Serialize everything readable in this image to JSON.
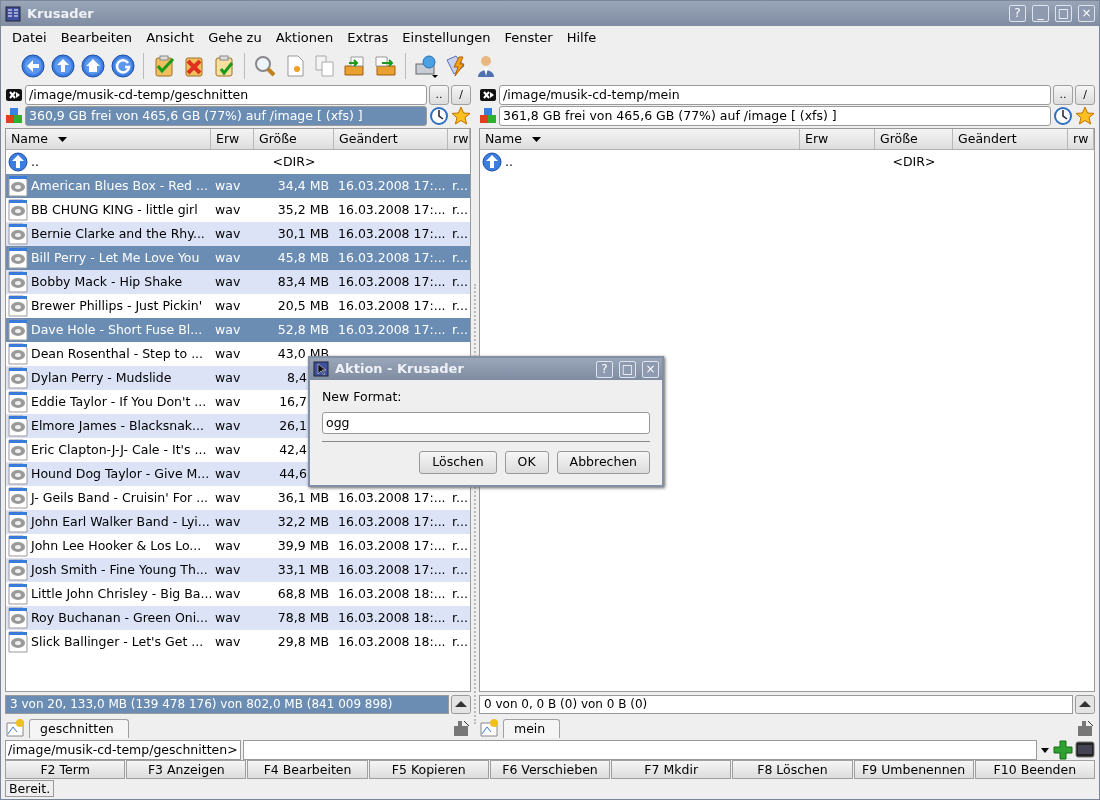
{
  "window": {
    "title": "Krusader",
    "controls": [
      "?",
      "_",
      "□",
      "×"
    ]
  },
  "menu": [
    "Datei",
    "Bearbeiten",
    "Ansicht",
    "Gehe zu",
    "Aktionen",
    "Extras",
    "Einstellungen",
    "Fenster",
    "Hilfe"
  ],
  "panels": [
    {
      "active": true,
      "path": "/image/musik-cd-temp/geschnitten",
      "path_buttons": [
        "..",
        "/"
      ],
      "free_space": "360,9 GB frei von 465,6 GB (77%) auf /image [ (xfs) ]",
      "columns": [
        "Name",
        "Erw",
        "Größe",
        "Geändert",
        "rw"
      ],
      "rows": [
        {
          "kind": "parent",
          "name": "..",
          "size": "<DIR>",
          "selected": false
        },
        {
          "kind": "file",
          "name": "American Blues Box - Red ...",
          "ext": "wav",
          "size": "34,4 MB",
          "date": "16.03.2008 17:...",
          "rw": "r...",
          "selected": true
        },
        {
          "kind": "file",
          "name": "BB CHUNG KING - little girl",
          "ext": "wav",
          "size": "35,2 MB",
          "date": "16.03.2008 17:...",
          "rw": "r...",
          "selected": false
        },
        {
          "kind": "file",
          "name": "Bernie Clarke and the Rhy...",
          "ext": "wav",
          "size": "30,1 MB",
          "date": "16.03.2008 17:...",
          "rw": "r...",
          "selected": false
        },
        {
          "kind": "file",
          "name": "Bill Perry - Let Me Love You",
          "ext": "wav",
          "size": "45,8 MB",
          "date": "16.03.2008 17:...",
          "rw": "r...",
          "selected": true
        },
        {
          "kind": "file",
          "name": "Bobby Mack - Hip Shake",
          "ext": "wav",
          "size": "83,4 MB",
          "date": "16.03.2008 17:...",
          "rw": "r...",
          "selected": false
        },
        {
          "kind": "file",
          "name": "Brewer Phillips - Just Pickin'",
          "ext": "wav",
          "size": "20,5 MB",
          "date": "16.03.2008 17:...",
          "rw": "r...",
          "selected": false
        },
        {
          "kind": "file",
          "name": "Dave Hole - Short Fuse Bl...",
          "ext": "wav",
          "size": "52,8 MB",
          "date": "16.03.2008 17:...",
          "rw": "r...",
          "selected": true
        },
        {
          "kind": "file",
          "name": "Dean Rosenthal - Step to ...",
          "ext": "wav",
          "size": "43,0 MB",
          "selected": false
        },
        {
          "kind": "file",
          "name": "Dylan Perry - Mudslide",
          "ext": "wav",
          "size": "8,4",
          "selected": false
        },
        {
          "kind": "file",
          "name": "Eddie Taylor - If You Don't ...",
          "ext": "wav",
          "size": "16,7",
          "selected": false
        },
        {
          "kind": "file",
          "name": "Elmore James - Blacksnak...",
          "ext": "wav",
          "size": "26,1",
          "selected": false
        },
        {
          "kind": "file",
          "name": "Eric Clapton-J-J- Cale - It's ...",
          "ext": "wav",
          "size": "42,4",
          "selected": false
        },
        {
          "kind": "file",
          "name": "Hound Dog Taylor - Give M...",
          "ext": "wav",
          "size": "44,6",
          "selected": false
        },
        {
          "kind": "file",
          "name": "J- Geils Band - Cruisin' For ...",
          "ext": "wav",
          "size": "36,1 MB",
          "date": "16.03.2008 17:...",
          "rw": "r...",
          "selected": false
        },
        {
          "kind": "file",
          "name": "John Earl Walker Band - Lyi...",
          "ext": "wav",
          "size": "32,2 MB",
          "date": "16.03.2008 17:...",
          "rw": "r...",
          "selected": false
        },
        {
          "kind": "file",
          "name": "John Lee Hooker & Los Lo...",
          "ext": "wav",
          "size": "39,9 MB",
          "date": "16.03.2008 17:...",
          "rw": "r...",
          "selected": false
        },
        {
          "kind": "file",
          "name": "Josh Smith - Fine Young Th...",
          "ext": "wav",
          "size": "33,1 MB",
          "date": "16.03.2008 17:...",
          "rw": "r...",
          "selected": false
        },
        {
          "kind": "file",
          "name": "Little John Chrisley - Big Ba...",
          "ext": "wav",
          "size": "68,8 MB",
          "date": "16.03.2008 18:...",
          "rw": "r...",
          "selected": false
        },
        {
          "kind": "file",
          "name": "Roy Buchanan - Green Oni...",
          "ext": "wav",
          "size": "78,8 MB",
          "date": "16.03.2008 18:...",
          "rw": "r...",
          "selected": false
        },
        {
          "kind": "file",
          "name": "Slick Ballinger - Let's Get ...",
          "ext": "wav",
          "size": "29,8 MB",
          "date": "16.03.2008 18:...",
          "rw": "r...",
          "selected": false
        }
      ],
      "status": "3 von 20, 133,0 MB (139 478 176) von 802,0 MB (841 009 898)",
      "tab": "geschnitten"
    },
    {
      "active": false,
      "path": "/image/musik-cd-temp/mein",
      "path_buttons": [
        "..",
        "/"
      ],
      "free_space": "361,8 GB frei von 465,6 GB (77%) auf /image [ (xfs) ]",
      "columns": [
        "Name",
        "Erw",
        "Größe",
        "Geändert",
        "rw"
      ],
      "rows": [
        {
          "kind": "parent",
          "name": "..",
          "size": "<DIR>",
          "selected": false
        }
      ],
      "status": "0 von 0, 0 B (0) von 0 B (0)",
      "tab": "mein"
    }
  ],
  "command_line": {
    "prompt": "/image/musik-cd-temp/geschnitten>"
  },
  "function_keys": [
    "F2 Term",
    "F3 Anzeigen",
    "F4 Bearbeiten",
    "F5 Kopieren",
    "F6 Verschieben",
    "F7 Mkdir",
    "F8 Löschen",
    "F9 Umbenennen",
    "F10 Beenden"
  ],
  "status_bar": "Bereit.",
  "dialog": {
    "title": "Aktion - Krusader",
    "controls": [
      "?",
      "□",
      "×"
    ],
    "label": "New Format:",
    "value": "ogg",
    "buttons": [
      "Löschen",
      "OK",
      "Abbrechen"
    ]
  }
}
